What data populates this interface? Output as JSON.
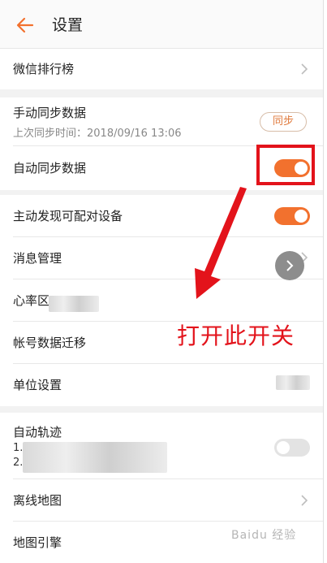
{
  "header": {
    "title": "设置",
    "back_icon": "back-arrow-icon"
  },
  "colors": {
    "accent": "#f2712e",
    "annotation": "#e3131b",
    "background": "#f2f2f2"
  },
  "group1": {
    "ranking": {
      "label": "微信排行榜"
    }
  },
  "group2": {
    "manual_sync": {
      "label": "手动同步数据",
      "last_sync": "上次同步时间：2018/09/16 13:06",
      "button": "同步"
    },
    "auto_sync": {
      "label": "自动同步数据",
      "state": "on"
    }
  },
  "group3": {
    "discover": {
      "label": "主动发现可配对设备",
      "state": "on"
    },
    "messages": {
      "label": "消息管理"
    },
    "heart_rate": {
      "label": "心率区"
    },
    "account_migration": {
      "label": "帐号数据迁移"
    },
    "units": {
      "label": "单位设置"
    }
  },
  "group4": {
    "auto_track": {
      "label": "自动轨迹",
      "line1_prefix": "1.",
      "line2_prefix": "2.",
      "state": "off"
    },
    "offline_map": {
      "label": "离线地图"
    },
    "map_engine": {
      "label": "地图引擎"
    }
  },
  "annotation": {
    "text": "打开此开关"
  },
  "watermark": "Baidu 经验"
}
